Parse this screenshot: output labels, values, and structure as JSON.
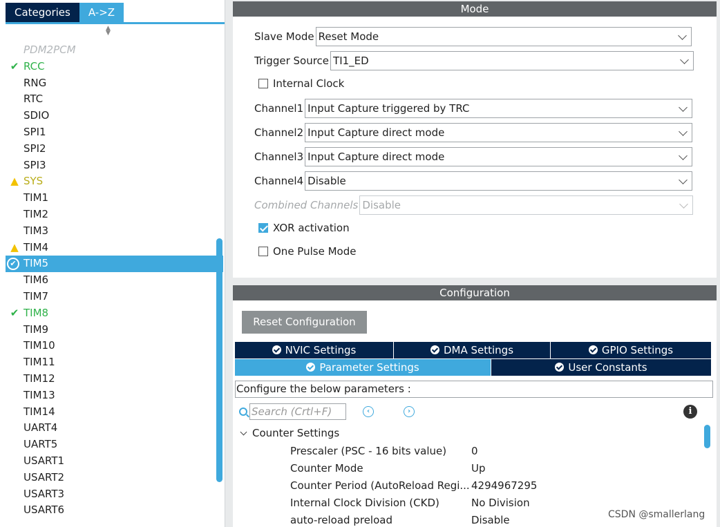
{
  "left_panel": {
    "tabs": [
      {
        "label": "Categories"
      },
      {
        "label": "A->Z"
      }
    ],
    "items": [
      {
        "label": "PDM2PCM",
        "state": "disabled"
      },
      {
        "label": "RCC",
        "state": "ok"
      },
      {
        "label": "RNG",
        "state": "normal"
      },
      {
        "label": "RTC",
        "state": "normal"
      },
      {
        "label": "SDIO",
        "state": "normal"
      },
      {
        "label": "SPI1",
        "state": "normal"
      },
      {
        "label": "SPI2",
        "state": "normal"
      },
      {
        "label": "SPI3",
        "state": "normal"
      },
      {
        "label": "SYS",
        "state": "warn"
      },
      {
        "label": "TIM1",
        "state": "normal"
      },
      {
        "label": "TIM2",
        "state": "normal"
      },
      {
        "label": "TIM3",
        "state": "normal"
      },
      {
        "label": "TIM4",
        "state": "warn-normal"
      },
      {
        "label": "TIM5",
        "state": "selected"
      },
      {
        "label": "TIM6",
        "state": "normal"
      },
      {
        "label": "TIM7",
        "state": "normal"
      },
      {
        "label": "TIM8",
        "state": "ok"
      },
      {
        "label": "TIM9",
        "state": "normal"
      },
      {
        "label": "TIM10",
        "state": "normal"
      },
      {
        "label": "TIM11",
        "state": "normal"
      },
      {
        "label": "TIM12",
        "state": "normal"
      },
      {
        "label": "TIM13",
        "state": "normal"
      },
      {
        "label": "TIM14",
        "state": "normal"
      },
      {
        "label": "UART4",
        "state": "normal"
      },
      {
        "label": "UART5",
        "state": "normal"
      },
      {
        "label": "USART1",
        "state": "normal"
      },
      {
        "label": "USART2",
        "state": "normal"
      },
      {
        "label": "USART3",
        "state": "normal"
      },
      {
        "label": "USART6",
        "state": "normal"
      }
    ]
  },
  "mode": {
    "title": "Mode",
    "slave_mode": {
      "label": "Slave Mode",
      "value": "Reset Mode"
    },
    "trigger_source": {
      "label": "Trigger Source",
      "value": "TI1_ED"
    },
    "internal_clock": {
      "label": "Internal Clock",
      "checked": false
    },
    "channel1": {
      "label": "Channel1",
      "value": "Input Capture triggered by TRC"
    },
    "channel2": {
      "label": "Channel2",
      "value": "Input Capture direct mode"
    },
    "channel3": {
      "label": "Channel3",
      "value": "Input Capture direct mode"
    },
    "channel4": {
      "label": "Channel4",
      "value": "Disable"
    },
    "combined_channels": {
      "label": "Combined Channels",
      "value": "Disable"
    },
    "xor_activation": {
      "label": "XOR activation",
      "checked": true
    },
    "one_pulse_mode": {
      "label": "One Pulse Mode",
      "checked": false
    }
  },
  "configuration": {
    "title": "Configuration",
    "reset_button": "Reset Configuration",
    "tabs": {
      "nvic": "NVIC Settings",
      "dma": "DMA Settings",
      "gpio": "GPIO Settings",
      "parameter": "Parameter Settings",
      "user_constants": "User Constants"
    },
    "configure_text": "Configure the below parameters :",
    "search_placeholder": "Search (Crtl+F)",
    "group": "Counter Settings",
    "params": [
      {
        "name": "Prescaler (PSC - 16 bits value)",
        "value": "0"
      },
      {
        "name": "Counter Mode",
        "value": "Up"
      },
      {
        "name": "Counter Period (AutoReload Regi...",
        "value": "4294967295"
      },
      {
        "name": "Internal Clock Division (CKD)",
        "value": "No Division"
      },
      {
        "name": "auto-reload preload",
        "value": "Disable"
      }
    ]
  },
  "watermark": "CSDN @smallerlang",
  "colors": {
    "accent": "#3fa9dd",
    "navy": "#03234b",
    "header_gray": "#606467",
    "ok_green": "#2fb24a",
    "warn_yellow": "#f2c200"
  }
}
